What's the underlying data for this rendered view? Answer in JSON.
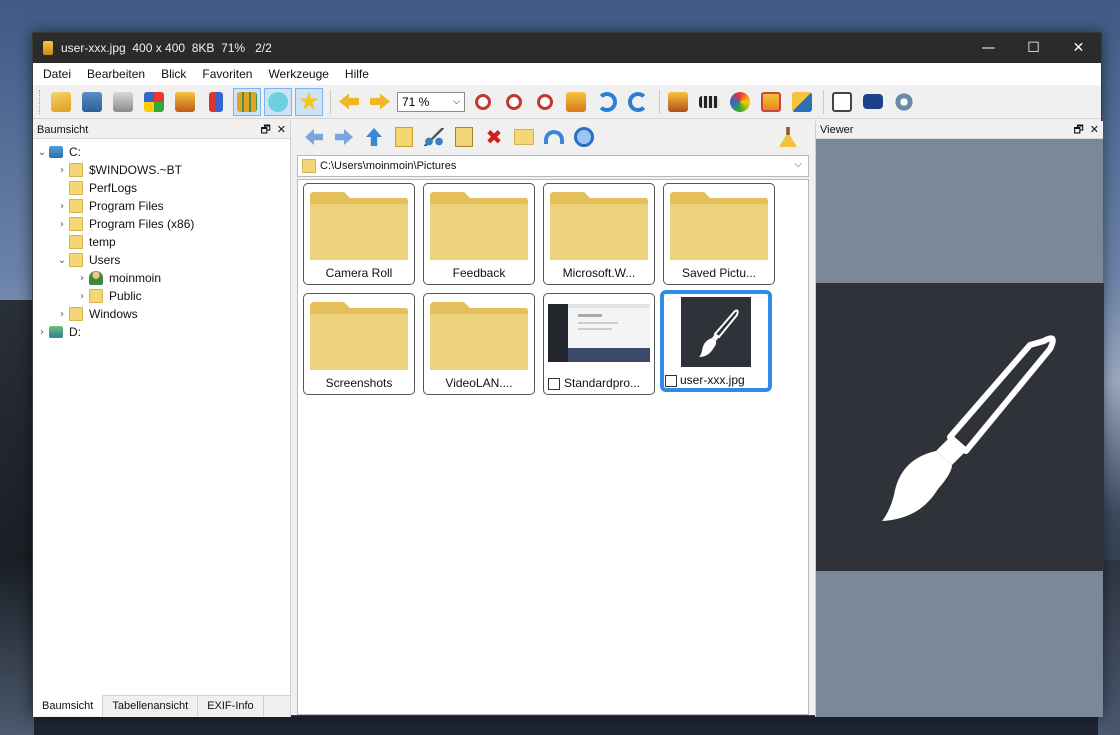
{
  "window": {
    "title": "user-xxx.jpg  400 x 400  8KB  71%   2/2",
    "controls": {
      "minimize": "—",
      "maximize": "☐",
      "close": "✕"
    }
  },
  "menu": [
    "Datei",
    "Bearbeiten",
    "Blick",
    "Favoriten",
    "Werkzeuge",
    "Hilfe"
  ],
  "toolbar": {
    "zoom_value": "71 %",
    "icons": [
      "open-folder-icon",
      "save-icon",
      "print-icon",
      "color-palette-icon",
      "image-icon",
      "sort-icon",
      "thumbnail-grid-icon",
      "speech-bubble-icon",
      "star-icon",
      "prev-arrow-icon",
      "next-arrow-icon",
      "zoom-in-icon",
      "zoom-out-icon",
      "zoom-fit-icon",
      "fullscreen-icon",
      "rotate-right-icon",
      "rotate-left-icon",
      "slideshow-icon",
      "filmstrip-icon",
      "paint-icon",
      "crop-icon",
      "resize-icon",
      "properties-icon",
      "camera-icon",
      "gear-icon"
    ]
  },
  "left_panel": {
    "title": "Baumsicht",
    "tree": [
      {
        "label": "C:",
        "level": 0,
        "expanded": true,
        "icon": "drive"
      },
      {
        "label": "$WINDOWS.~BT",
        "level": 1,
        "expandable": true,
        "icon": "folder"
      },
      {
        "label": "PerfLogs",
        "level": 1,
        "expandable": false,
        "icon": "folder"
      },
      {
        "label": "Program Files",
        "level": 1,
        "expandable": true,
        "icon": "folder"
      },
      {
        "label": "Program Files (x86)",
        "level": 1,
        "expandable": true,
        "icon": "folder"
      },
      {
        "label": "temp",
        "level": 1,
        "expandable": false,
        "icon": "folder"
      },
      {
        "label": "Users",
        "level": 1,
        "expanded": true,
        "icon": "folder"
      },
      {
        "label": "moinmoin",
        "level": 2,
        "expandable": true,
        "icon": "user"
      },
      {
        "label": "Public",
        "level": 2,
        "expandable": true,
        "icon": "folder"
      },
      {
        "label": "Windows",
        "level": 1,
        "expandable": true,
        "icon": "folder"
      },
      {
        "label": "D:",
        "level": 0,
        "expandable": true,
        "icon": "drive"
      }
    ],
    "tabs": [
      "Baumsicht",
      "Tabellenansicht",
      "EXIF-Info"
    ],
    "active_tab": "Baumsicht"
  },
  "center": {
    "address": "C:\\Users\\moinmoin\\Pictures",
    "thumbnails": [
      {
        "label": "Camera Roll",
        "type": "folder"
      },
      {
        "label": "Feedback",
        "type": "folder"
      },
      {
        "label": "Microsoft.W...",
        "type": "folder"
      },
      {
        "label": "Saved Pictu...",
        "type": "folder"
      },
      {
        "label": "Screenshots",
        "type": "folder"
      },
      {
        "label": "VideoLAN....",
        "type": "folder"
      },
      {
        "label": "Standardpro...",
        "type": "image"
      },
      {
        "label": "user-xxx.jpg",
        "type": "image",
        "selected": true
      }
    ]
  },
  "right_panel": {
    "title": "Viewer"
  },
  "colors": {
    "titlebar": "#2b2b2b",
    "selection": "#2f8be6",
    "folder": "#f5d676",
    "viewer_bg": "#7a8898",
    "image_bg": "#2f3238"
  }
}
